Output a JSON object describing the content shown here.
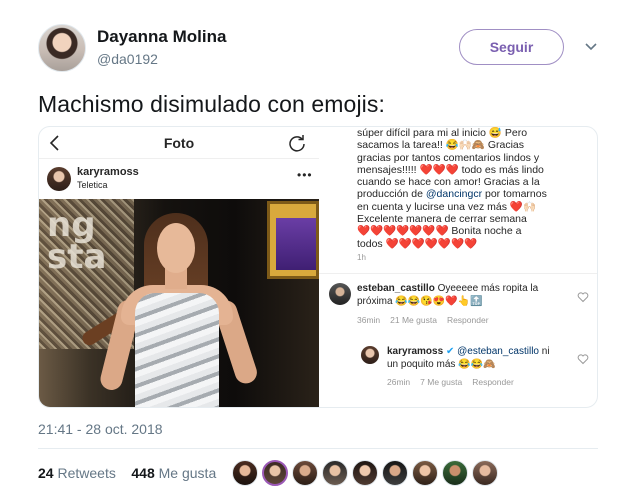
{
  "header": {
    "name": "Dayanna Molina",
    "handle": "@da0192",
    "follow_label": "Seguir"
  },
  "tweet": {
    "text": "Machismo disimulado con emojis:"
  },
  "instagram": {
    "title": "Foto",
    "post_user": "karyramoss",
    "post_location": "Teletica",
    "caption_lines": [
      "súper difícil para mi al inicio 😅 Pero",
      "sacamos la tarea!! 😂🙌🏻🙈 Gracias",
      "gracias por tantos comentarios lindos y",
      "mensajes!!!!! ❤️❤️❤️ todo es más lindo",
      "cuando se hace con amor! Gracias a la",
      "producción de @dancingcr por tomarnos",
      "en cuenta y lucirse una vez más ❤️🙌🏻",
      "Excelente manera de cerrar semana",
      "❤️❤️❤️❤️❤️❤️❤️ Bonita noche a",
      "todos ❤️❤️❤️❤️❤️❤️❤️"
    ],
    "caption_time": "1h",
    "comments": [
      {
        "user": "esteban_castillo",
        "text_line1": "Oyeeeee más ropita la",
        "text_line2": "próxima 😂😂😘😍❤️👆🔝",
        "time": "36min",
        "likes": "21 Me gusta",
        "reply": "Responder"
      },
      {
        "user": "karyramoss",
        "mention": "@esteban_castillo",
        "text_line1": "ni",
        "text_line2": "un poquito más 😂😂🙈",
        "time": "26min",
        "likes": "7 Me gusta",
        "reply": "Responder"
      }
    ]
  },
  "footer": {
    "timestamp": "21:41 - 28 oct. 2018",
    "retweets_count": "24",
    "retweets_label": "Retweets",
    "likes_count": "448",
    "likes_label": "Me gusta"
  },
  "colors": {
    "follow_border": "#a08fc4",
    "follow_text": "#7a5fb0",
    "muted": "#657786",
    "mention": "#003569"
  },
  "icons": [
    "chevron-down-icon",
    "back-arrow-icon",
    "refresh-icon",
    "more-icon",
    "heart-icon"
  ]
}
